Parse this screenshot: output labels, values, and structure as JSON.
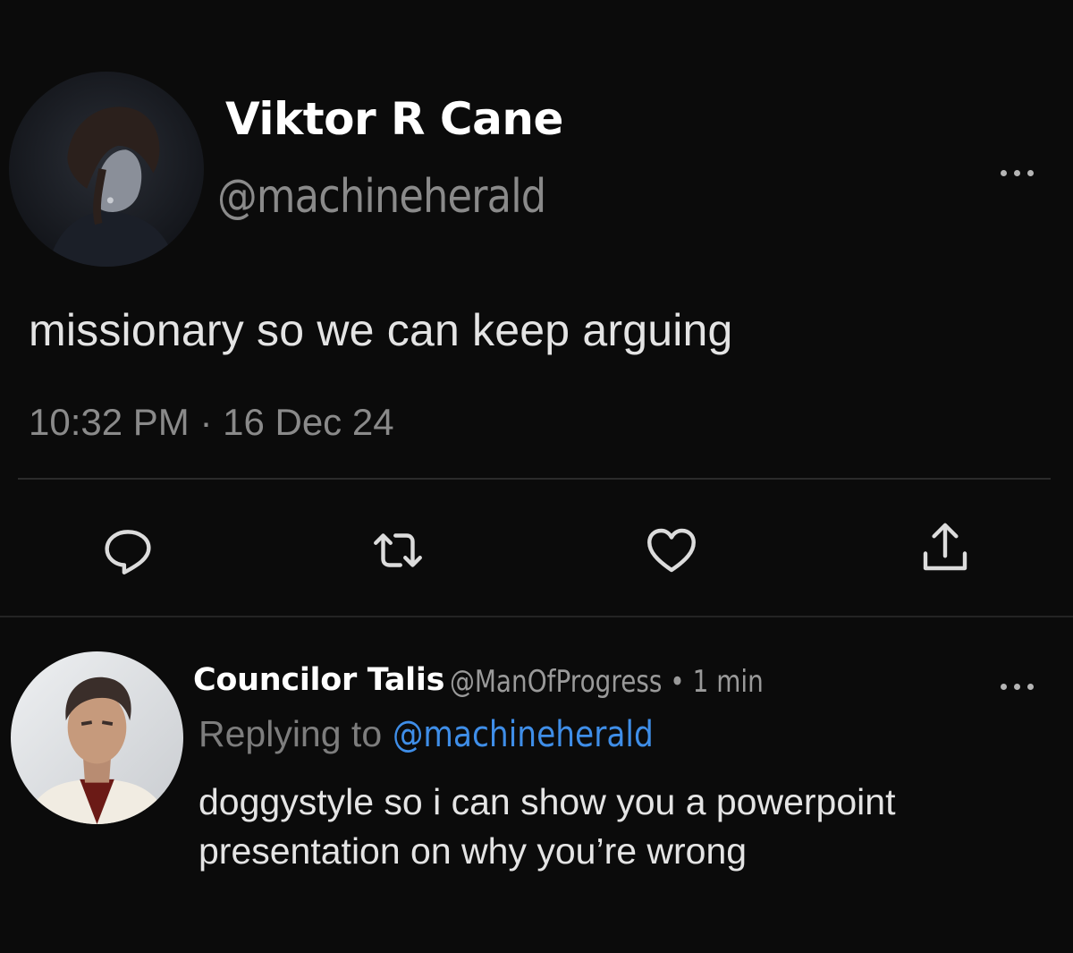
{
  "tweet": {
    "display_name": "Viktor R Cane",
    "handle": "@machineherald",
    "text": "missionary so we can keep arguing",
    "time": "10:32 PM · 16 Dec 24",
    "more_icon": "ellipsis-icon",
    "actions": [
      {
        "name": "reply",
        "icon": "speech-bubble-icon"
      },
      {
        "name": "retweet",
        "icon": "retweet-arrows-icon"
      },
      {
        "name": "like",
        "icon": "heart-icon"
      },
      {
        "name": "share",
        "icon": "share-upload-icon"
      }
    ]
  },
  "reply": {
    "display_name": "Councilor Talis",
    "handle_meta": "@ManOfProgress • 1 min",
    "replying_label": "Replying to",
    "replying_handle": "@machineherald",
    "text": "doggystyle so i can show you a powerpoint presentation on why you’re wrong",
    "more_icon": "ellipsis-icon"
  },
  "colors": {
    "background": "#0b0b0b",
    "link": "#3f8ee8",
    "muted": "#8a8a8a"
  }
}
